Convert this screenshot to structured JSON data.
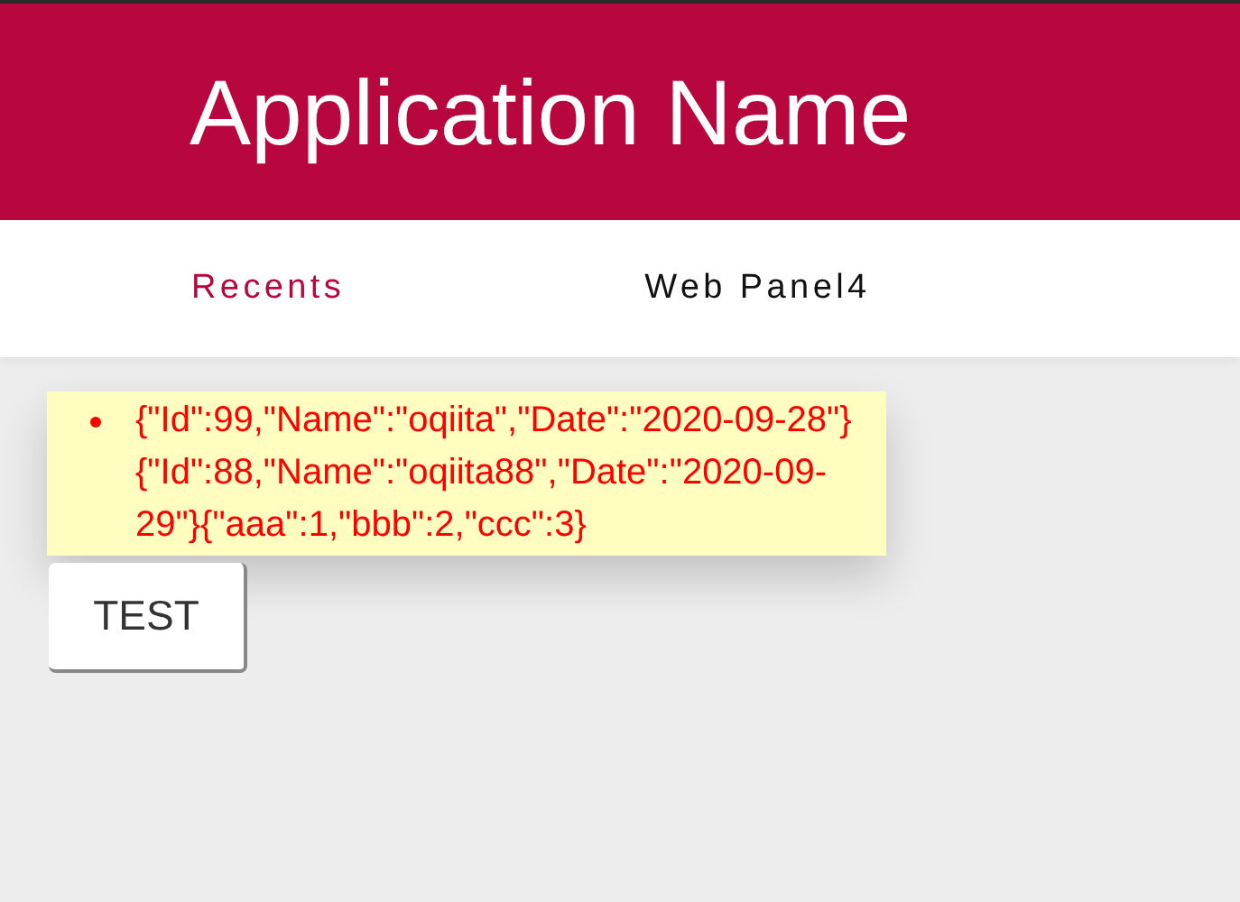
{
  "header": {
    "title": "Application Name"
  },
  "tabs": [
    {
      "label": "Recents",
      "selected": true
    },
    {
      "label": "Web Panel4",
      "selected": false
    }
  ],
  "list": {
    "items": [
      "{\"Id\":99,\"Name\":\"oqiita\",\"Date\":\"2020-09-28\"}{\"Id\":88,\"Name\":\"oqiita88\",\"Date\":\"2020-09-29\"}{\"aaa\":1,\"bbb\":2,\"ccc\":3}"
    ]
  },
  "button": {
    "label": "TEST"
  }
}
